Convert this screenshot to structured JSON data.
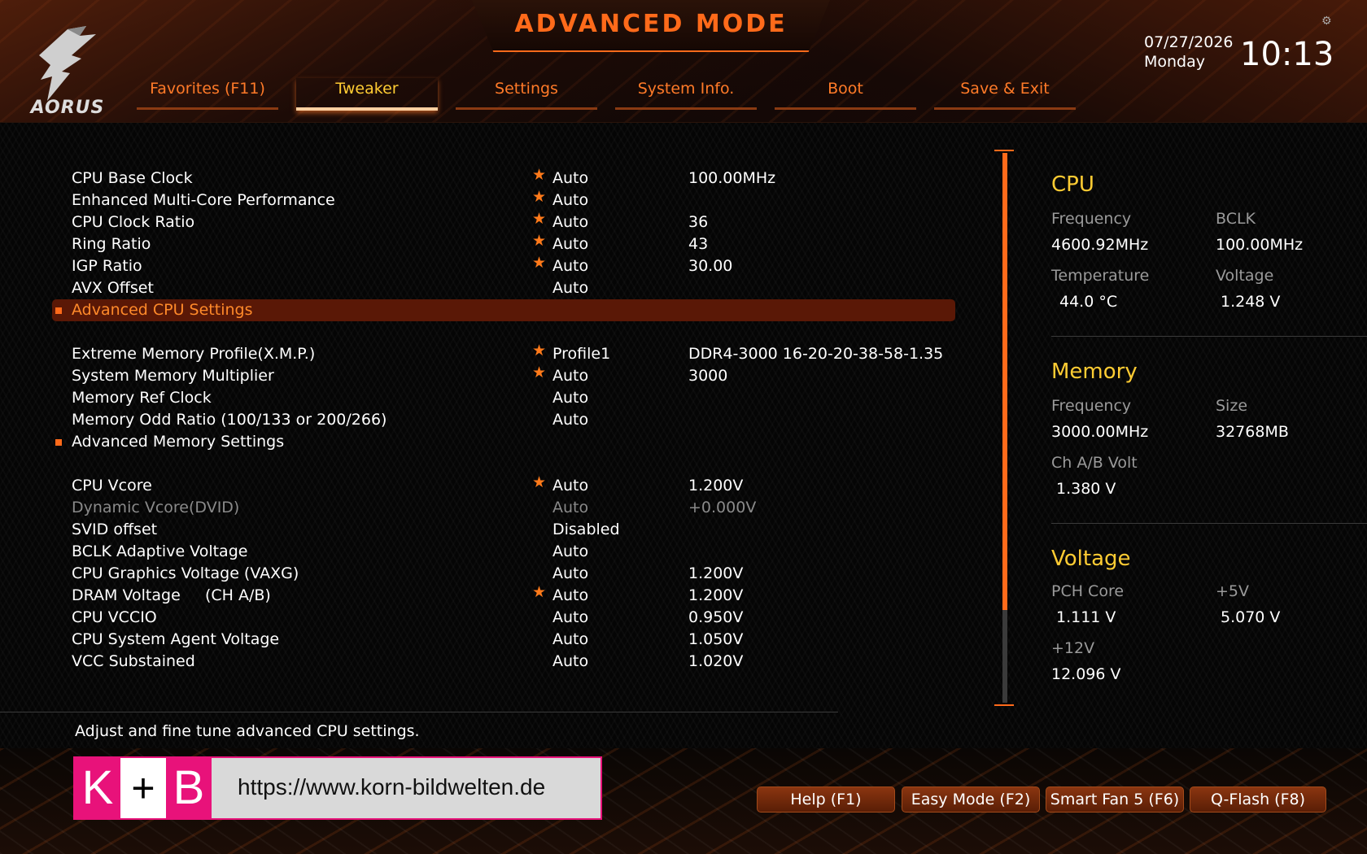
{
  "header": {
    "title": "ADVANCED MODE",
    "brand": "AORUS",
    "date": "07/27/2026",
    "weekday": "Monday",
    "time": "10:13"
  },
  "tabs": [
    {
      "label": "Favorites (F11)",
      "active": false
    },
    {
      "label": "Tweaker",
      "active": true
    },
    {
      "label": "Settings",
      "active": false
    },
    {
      "label": "System Info.",
      "active": false
    },
    {
      "label": "Boot",
      "active": false
    },
    {
      "label": "Save & Exit",
      "active": false
    }
  ],
  "settings": [
    {
      "label": "CPU Base Clock",
      "star": "★",
      "value": "Auto",
      "current": "100.00MHz"
    },
    {
      "label": "Enhanced Multi-Core Performance",
      "star": "★",
      "value": "Auto",
      "current": ""
    },
    {
      "label": "CPU Clock Ratio",
      "star": "★",
      "value": "Auto",
      "current": "36"
    },
    {
      "label": "Ring Ratio",
      "star": "★",
      "value": "Auto",
      "current": "43"
    },
    {
      "label": "IGP Ratio",
      "star": "★",
      "value": "Auto",
      "current": "30.00"
    },
    {
      "label": "AVX Offset",
      "star": "",
      "value": "Auto",
      "current": ""
    },
    {
      "label": "Advanced CPU Settings",
      "star": "",
      "value": "",
      "current": ""
    },
    {
      "label": "Extreme Memory Profile(X.M.P.)",
      "star": "★",
      "value": "Profile1",
      "current": "DDR4-3000 16-20-20-38-58-1.35"
    },
    {
      "label": "System Memory Multiplier",
      "star": "★",
      "value": "Auto",
      "current": "3000"
    },
    {
      "label": "Memory Ref Clock",
      "star": "",
      "value": "Auto",
      "current": ""
    },
    {
      "label": "Memory Odd Ratio (100/133 or 200/266)",
      "star": "",
      "value": "Auto",
      "current": ""
    },
    {
      "label": "Advanced Memory Settings",
      "star": "",
      "value": "",
      "current": ""
    },
    {
      "label": "CPU Vcore",
      "star": "★",
      "value": "Auto",
      "current": "1.200V"
    },
    {
      "label": "Dynamic Vcore(DVID)",
      "star": "",
      "value": "Auto",
      "current": "+0.000V"
    },
    {
      "label": "SVID offset",
      "star": "",
      "value": "Disabled",
      "current": ""
    },
    {
      "label": "BCLK Adaptive Voltage",
      "star": "",
      "value": "Auto",
      "current": ""
    },
    {
      "label": "CPU Graphics Voltage (VAXG)",
      "star": "",
      "value": "Auto",
      "current": "1.200V"
    },
    {
      "label": "DRAM Voltage     (CH A/B)",
      "star": "★",
      "value": "Auto",
      "current": "1.200V"
    },
    {
      "label": "CPU VCCIO",
      "star": "",
      "value": "Auto",
      "current": "0.950V"
    },
    {
      "label": "CPU System Agent Voltage",
      "star": "",
      "value": "Auto",
      "current": "1.050V"
    },
    {
      "label": "VCC Substained",
      "star": "",
      "value": "Auto",
      "current": "1.020V"
    }
  ],
  "info": {
    "cpu": {
      "title": "CPU",
      "frequency_label": "Frequency",
      "frequency": "4600.92MHz",
      "bclk_label": "BCLK",
      "bclk": "100.00MHz",
      "temperature_label": "Temperature",
      "temperature": "44.0 °C",
      "voltage_label": "Voltage",
      "voltage": "1.248 V"
    },
    "memory": {
      "title": "Memory",
      "frequency_label": "Frequency",
      "frequency": "3000.00MHz",
      "size_label": "Size",
      "size": "32768MB",
      "volt_label": "Ch A/B Volt",
      "volt": "1.380 V"
    },
    "voltage": {
      "title": "Voltage",
      "pch_label": "PCH Core",
      "pch": "1.111 V",
      "p5v_label": "+5V",
      "p5v": "5.070 V",
      "p12v_label": "+12V",
      "p12v": "12.096 V"
    }
  },
  "help_text": "Adjust and fine tune advanced CPU settings.",
  "watermark": {
    "k": "K",
    "plus": "+",
    "b": "B",
    "url": "https://www.korn-bildwelten.de"
  },
  "buttons": [
    {
      "label": "Help (F1)"
    },
    {
      "label": "Easy Mode (F2)"
    },
    {
      "label": "Smart Fan 5 (F6)"
    },
    {
      "label": "Q-Flash (F8)"
    }
  ],
  "colors": {
    "accent": "#ff6a1a",
    "highlight": "#ffcc33",
    "selected_row": "#5a1806"
  }
}
